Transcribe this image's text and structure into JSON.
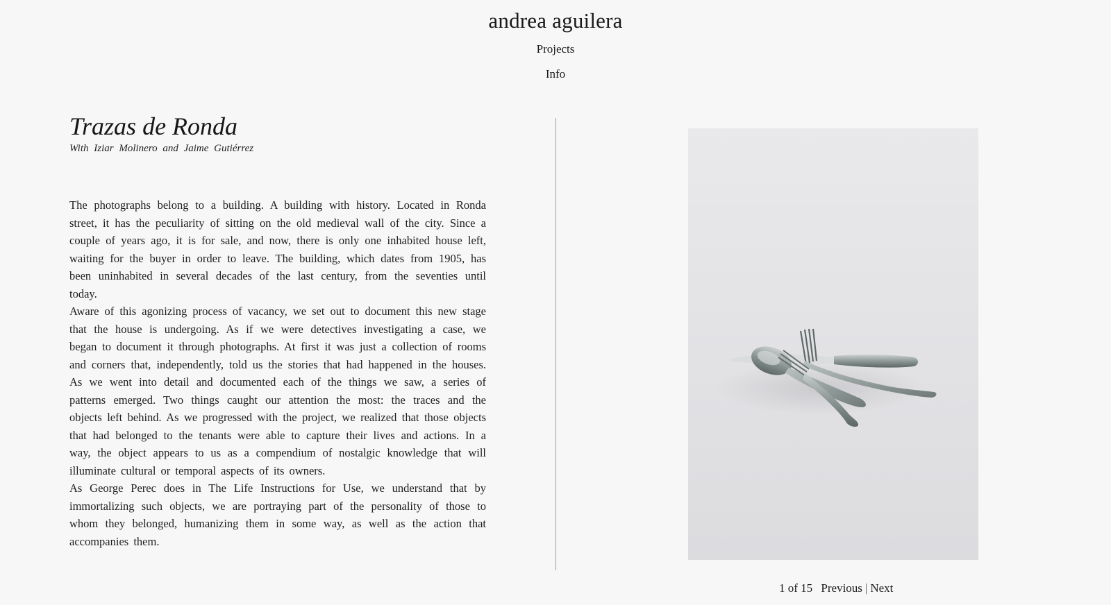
{
  "site": {
    "title": "andrea aguilera"
  },
  "nav": {
    "items": [
      {
        "label": "Projects"
      },
      {
        "label": "Info"
      }
    ]
  },
  "project": {
    "title": "Trazas de Ronda",
    "credits": "With Iziar Molinero and Jaime Gutiérrez",
    "paragraphs": [
      "The photographs belong to a building. A building with history. Located in Ronda street, it has the peculiarity of sitting on the old medieval wall of the city. Since a couple of years ago, it is for sale, and now, there is only one inhabited house left, waiting for the buyer in order to leave. The building, which dates from 1905, has been uninhabited in several decades of the last century, from the seventies until today.",
      "Aware of this agonizing process of vacancy, we set out to document this new stage that the house is undergoing. As if we were detectives investigating a case, we began to document it through photographs. At first it was just a collection of rooms and corners that, independently, told us the stories that had happened in the houses. As we went into detail and documented each of the things we saw, a series of patterns emerged. Two things caught our attention the most: the traces and the objects left behind. As we progressed with the project, we realized that those objects that had belonged to the tenants were able to capture their lives and actions. In a way, the object appears to us as a compendium of nostalgic knowledge that will illuminate cultural or temporal aspects of its owners.",
      "As George Perec does in The Life Instructions for Use, we understand that by immortalizing such objects, we are portraying part of the personality of those to whom they belonged, humanizing them in some way, as well as the action that accompanies them."
    ]
  },
  "gallery": {
    "counter": "1 of 15",
    "previous": "Previous",
    "separator": "|",
    "next": "Next"
  },
  "colors": {
    "background": "#f7f7f7",
    "text": "#1c1c1c",
    "divider": "#9a9a9a",
    "photo_background": "#e4e4e7"
  }
}
